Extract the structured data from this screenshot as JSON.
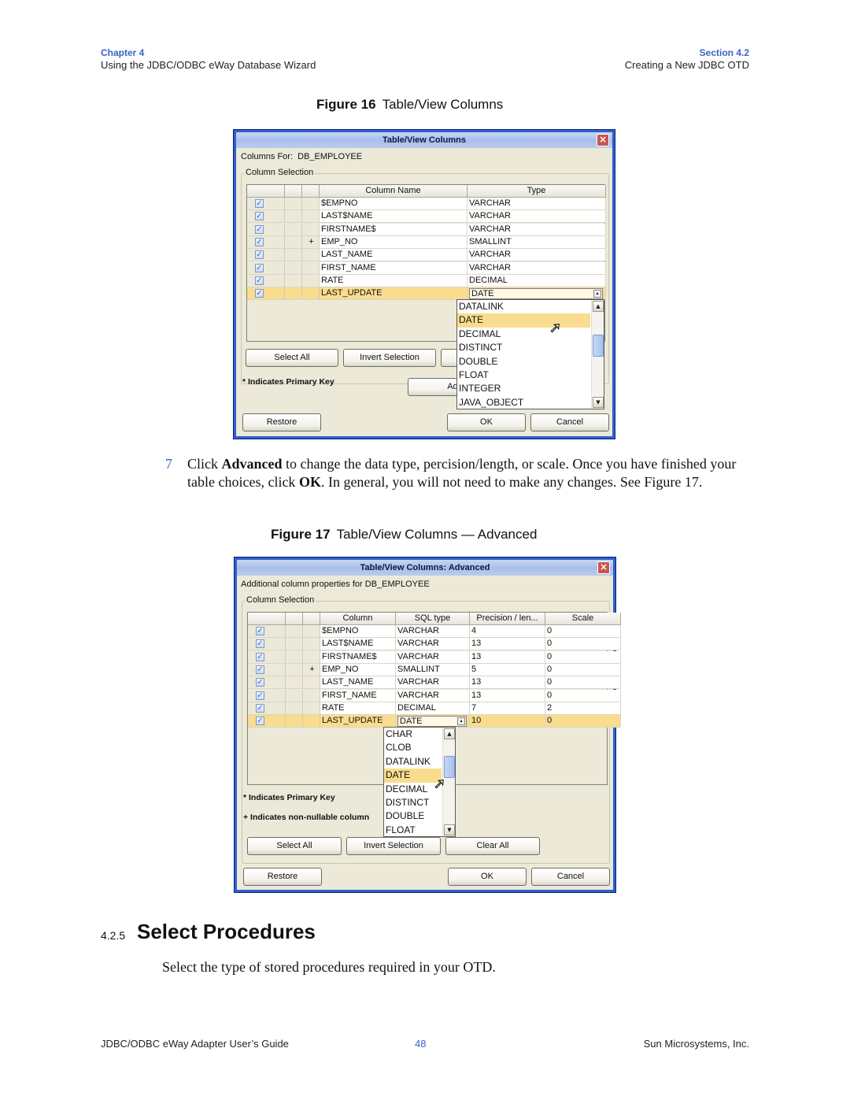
{
  "header": {
    "chapter_label": "Chapter 4",
    "chapter_title": "Using the JDBC/ODBC eWay Database Wizard",
    "section_label": "Section 4.2",
    "section_title": "Creating a New JDBC OTD"
  },
  "figure16": {
    "caption_num": "Figure 16",
    "caption_text": "Table/View Columns",
    "dialog": {
      "title": "Table/View Columns",
      "columns_for_label": "Columns For:",
      "table_name": "DB_EMPLOYEE",
      "group_label": "Column Selection",
      "headers": [
        "",
        "",
        "",
        "Column Name",
        "Type"
      ],
      "rows": [
        {
          "checked": true,
          "flag": "",
          "name": "$EMPNO",
          "type": "VARCHAR"
        },
        {
          "checked": true,
          "flag": "",
          "name": "LAST$NAME",
          "type": "VARCHAR"
        },
        {
          "checked": true,
          "flag": "",
          "name": "FIRSTNAME$",
          "type": "VARCHAR"
        },
        {
          "checked": true,
          "flag": "+",
          "name": "EMP_NO",
          "type": "SMALLINT"
        },
        {
          "checked": true,
          "flag": "",
          "name": "LAST_NAME",
          "type": "VARCHAR"
        },
        {
          "checked": true,
          "flag": "",
          "name": "FIRST_NAME",
          "type": "VARCHAR"
        },
        {
          "checked": true,
          "flag": "",
          "name": "RATE",
          "type": "DECIMAL"
        },
        {
          "checked": true,
          "flag": "",
          "name": "LAST_UPDATE",
          "type": "DATE",
          "selected": true
        }
      ],
      "dropdown_items": [
        "DATALINK",
        "DATE",
        "DECIMAL",
        "DISTINCT",
        "DOUBLE",
        "FLOAT",
        "INTEGER",
        "JAVA_OBJECT"
      ],
      "dropdown_highlight": "DATE",
      "buttons": {
        "select_all": "Select All",
        "invert_selection": "Invert Selection",
        "advanced": "Advance",
        "restore": "Restore",
        "ok": "OK",
        "cancel": "Cancel"
      },
      "primary_key_note": "* Indicates Primary Key"
    }
  },
  "step7": {
    "number": "7",
    "text_parts": [
      "Click ",
      "Advanced",
      " to change the data type, percision/length, or scale. Once you have finished your table choices, click ",
      "OK",
      ". In general, you will not need to make any changes. See Figure 17."
    ]
  },
  "figure17": {
    "caption_num": "Figure 17",
    "caption_text": "Table/View Columns — Advanced",
    "dialog": {
      "title": "Table/View Columns: Advanced",
      "description": "Additional column properties for DB_EMPLOYEE",
      "group_label": "Column Selection",
      "headers": [
        "",
        "",
        "",
        "Column",
        "SQL type",
        "Precision / len...",
        "Scale"
      ],
      "rows": [
        {
          "checked": true,
          "flag": "",
          "name": "$EMPNO",
          "type": "VARCHAR",
          "precision": "4",
          "scale": "0"
        },
        {
          "checked": true,
          "flag": "",
          "name": "LAST$NAME",
          "type": "VARCHAR",
          "precision": "13",
          "scale": "0"
        },
        {
          "checked": true,
          "flag": "",
          "name": "FIRSTNAME$",
          "type": "VARCHAR",
          "precision": "13",
          "scale": "0"
        },
        {
          "checked": true,
          "flag": "+",
          "name": "EMP_NO",
          "type": "SMALLINT",
          "precision": "5",
          "scale": "0"
        },
        {
          "checked": true,
          "flag": "",
          "name": "LAST_NAME",
          "type": "VARCHAR",
          "precision": "13",
          "scale": "0"
        },
        {
          "checked": true,
          "flag": "",
          "name": "FIRST_NAME",
          "type": "VARCHAR",
          "precision": "13",
          "scale": "0"
        },
        {
          "checked": true,
          "flag": "",
          "name": "RATE",
          "type": "DECIMAL",
          "precision": "7",
          "scale": "2"
        },
        {
          "checked": true,
          "flag": "",
          "name": "LAST_UPDATE",
          "type": "DATE",
          "precision": "10",
          "scale": "0",
          "selected": true
        }
      ],
      "dropdown_items": [
        "CHAR",
        "CLOB",
        "DATALINK",
        "DATE",
        "DECIMAL",
        "DISTINCT",
        "DOUBLE",
        "FLOAT"
      ],
      "dropdown_highlight": "DATE",
      "primary_key_note": "* Indicates Primary Key",
      "nonnullable_note": "+ Indicates non-nullable column",
      "buttons": {
        "select_all": "Select All",
        "invert_selection": "Invert Selection",
        "clear_all": "Clear All",
        "restore": "Restore",
        "ok": "OK",
        "cancel": "Cancel"
      }
    }
  },
  "section": {
    "number": "4.2.5",
    "title": "Select Procedures",
    "body": "Select the type of stored procedures required in your OTD."
  },
  "footer": {
    "left": "JDBC/ODBC eWay Adapter User’s Guide",
    "page": "48",
    "right": "Sun Microsystems, Inc."
  }
}
